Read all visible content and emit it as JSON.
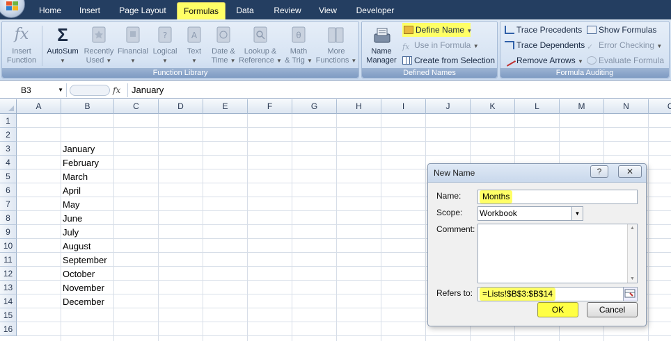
{
  "ribbon": {
    "tabs": [
      {
        "label": "Home",
        "active": false
      },
      {
        "label": "Insert",
        "active": false
      },
      {
        "label": "Page Layout",
        "active": false
      },
      {
        "label": "Formulas",
        "active": true
      },
      {
        "label": "Data",
        "active": false
      },
      {
        "label": "Review",
        "active": false
      },
      {
        "label": "View",
        "active": false
      },
      {
        "label": "Developer",
        "active": false
      }
    ],
    "function_library": {
      "label": "Function Library",
      "insert_function": {
        "line1": "Insert",
        "line2": "Function"
      },
      "autosum": {
        "line1": "AutoSum"
      },
      "recently_used": {
        "line1": "Recently",
        "line2": "Used"
      },
      "financial": {
        "line1": "Financial"
      },
      "logical": {
        "line1": "Logical"
      },
      "text": {
        "line1": "Text"
      },
      "date_time": {
        "line1": "Date &",
        "line2": "Time"
      },
      "lookup_reference": {
        "line1": "Lookup &",
        "line2": "Reference"
      },
      "math_trig": {
        "line1": "Math",
        "line2": "& Trig"
      },
      "more_functions": {
        "line1": "More",
        "line2": "Functions"
      }
    },
    "defined_names": {
      "label": "Defined Names",
      "name_manager": {
        "line1": "Name",
        "line2": "Manager"
      },
      "define_name": "Define Name",
      "use_in_formula": "Use in Formula",
      "create_from_selection": "Create from Selection"
    },
    "formula_auditing": {
      "label": "Formula Auditing",
      "trace_precedents": "Trace Precedents",
      "trace_dependents": "Trace Dependents",
      "remove_arrows": "Remove Arrows",
      "show_formulas": "Show Formulas",
      "error_checking": "Error Checking",
      "evaluate_formula": "Evaluate Formula"
    },
    "highlight_color": "#ffff66"
  },
  "formula_bar": {
    "name_box": "B3",
    "fx": "fx",
    "content": "January"
  },
  "sheet": {
    "columns": [
      "A",
      "B",
      "C",
      "D",
      "E",
      "F",
      "G",
      "H",
      "I",
      "J",
      "K",
      "L",
      "M",
      "N",
      "O"
    ],
    "rows": [
      "1",
      "2",
      "3",
      "4",
      "5",
      "6",
      "7",
      "8",
      "9",
      "10",
      "11",
      "12",
      "13",
      "14",
      "15",
      "16"
    ],
    "column_b_values": [
      "",
      "",
      "January",
      "February",
      "March",
      "April",
      "May",
      "June",
      "July",
      "August",
      "September",
      "October",
      "November",
      "December",
      "",
      ""
    ]
  },
  "dialog": {
    "title": "New Name",
    "help_label": "?",
    "close_label": "✕",
    "name_label": "Name:",
    "name_value": "Months",
    "scope_label": "Scope:",
    "scope_value": "Workbook",
    "comment_label": "Comment:",
    "refers_to_label": "Refers to:",
    "refers_to_value": "=Lists!$B$3:$B$14",
    "ok_label": "OK",
    "cancel_label": "Cancel"
  }
}
